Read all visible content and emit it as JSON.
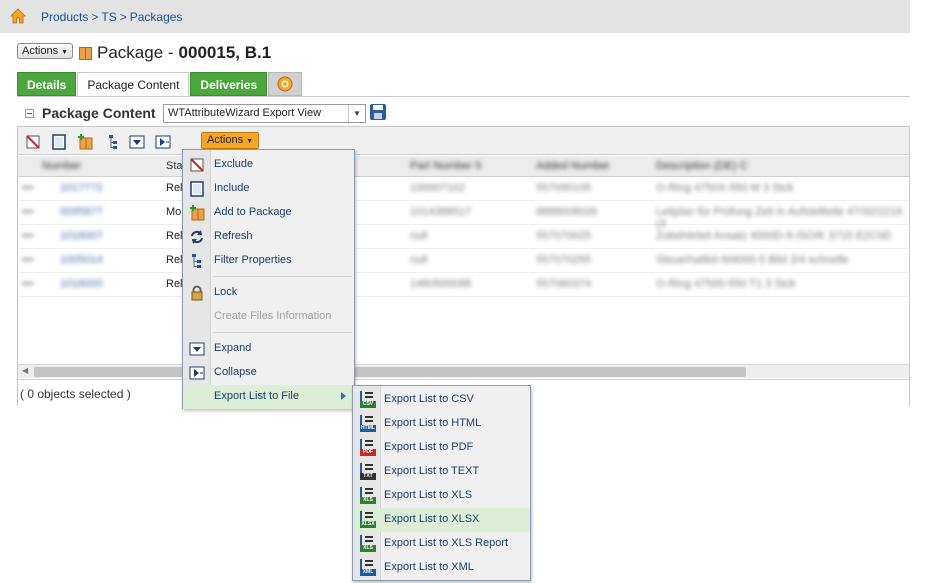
{
  "breadcrumb": {
    "items": [
      "Products",
      "TS",
      "Packages"
    ],
    "separator": ">"
  },
  "header": {
    "actions_label": "Actions",
    "object_type": "Package -",
    "object_id": "000015, B.1"
  },
  "tabs": [
    {
      "label": "Details",
      "active": false
    },
    {
      "label": "Package Content",
      "active": true
    },
    {
      "label": "Deliveries",
      "active": false
    }
  ],
  "section": {
    "title": "Package Content",
    "view_select_value": "WTAttributeWizard Export View"
  },
  "toolbar": {
    "actions_label": "Actions"
  },
  "grid": {
    "columns": [
      "Status"
    ],
    "column_visible_prefix": "Sta",
    "rows": [
      {
        "status": "Rel"
      },
      {
        "status": "Mo"
      },
      {
        "status": "Rel"
      },
      {
        "status": "Rel"
      },
      {
        "status": "Rel"
      }
    ]
  },
  "status_bar": {
    "text": "( 0 objects selected )"
  },
  "actions_menu": {
    "items": [
      {
        "label": "Exclude",
        "icon": "exclude-icon",
        "enabled": true
      },
      {
        "label": "Include",
        "icon": "include-icon",
        "enabled": true
      },
      {
        "label": "Add to Package",
        "icon": "add-to-package-icon",
        "enabled": true
      },
      {
        "label": "Refresh",
        "icon": "refresh-icon",
        "enabled": true
      },
      {
        "label": "Filter Properties",
        "icon": "filter-properties-icon",
        "enabled": true
      },
      {
        "label": "Lock",
        "icon": "lock-icon",
        "enabled": true
      },
      {
        "label": "Create Files Information",
        "icon": "",
        "enabled": false
      },
      {
        "label": "Expand",
        "icon": "expand-icon",
        "enabled": true
      },
      {
        "label": "Collapse",
        "icon": "collapse-icon",
        "enabled": true
      },
      {
        "label": "Export List to File",
        "icon": "",
        "enabled": true,
        "highlighted": true,
        "has_submenu": true
      }
    ]
  },
  "export_menu": {
    "items": [
      {
        "label": "Export List to CSV",
        "tag": "CSV",
        "color": "#2e7d32"
      },
      {
        "label": "Export List to HTML",
        "tag": "HTML",
        "color": "#1e5a9c"
      },
      {
        "label": "Export List to PDF",
        "tag": "PDF",
        "color": "#c62828"
      },
      {
        "label": "Export List to TEXT",
        "tag": "TXT",
        "color": "#333333"
      },
      {
        "label": "Export List to XLS",
        "tag": "XLS",
        "color": "#2e7d32"
      },
      {
        "label": "Export List to XLSX",
        "tag": "XLSX",
        "color": "#2e7d32",
        "highlighted": true
      },
      {
        "label": "Export List to XLS Report",
        "tag": "XLS",
        "color": "#2e7d32"
      },
      {
        "label": "Export List to XML",
        "tag": "XML",
        "color": "#1e5a9c"
      }
    ]
  },
  "colors": {
    "accent_green": "#4aa83c",
    "actions_orange": "#f5a623",
    "link_blue": "#1a4f99",
    "menu_highlight": "#dcefd6"
  }
}
